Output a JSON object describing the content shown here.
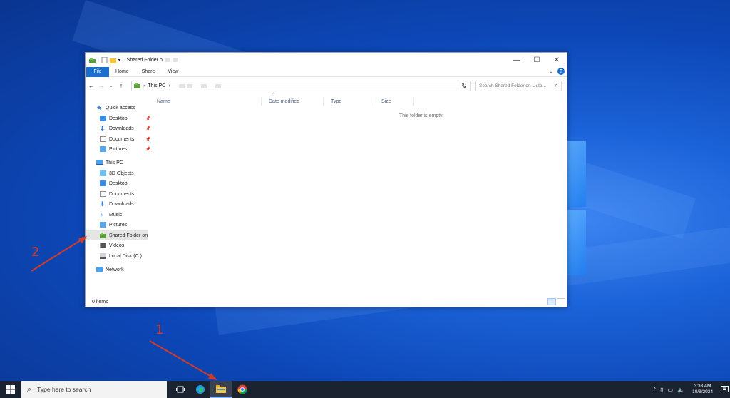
{
  "window": {
    "title": "Shared Folder o",
    "controls": {
      "minimize": "—",
      "maximize": "☐",
      "close": "✕"
    }
  },
  "ribbon": {
    "file_label": "File",
    "tabs": [
      "Home",
      "Share",
      "View"
    ],
    "help_label": "?"
  },
  "address": {
    "crumb_root": "This PC",
    "separator": "›",
    "search_placeholder": "Search Shared Folder on Liuta..."
  },
  "navigation": {
    "quick_access_label": "Quick access",
    "quick_access_items": [
      "Desktop",
      "Downloads",
      "Documents",
      "Pictures"
    ],
    "this_pc_label": "This PC",
    "this_pc_items": [
      "3D Objects",
      "Desktop",
      "Documents",
      "Downloads",
      "Music",
      "Pictures",
      "Shared Folder on",
      "Videos",
      "Local Disk (C:)"
    ],
    "network_label": "Network"
  },
  "columns": [
    "Name",
    "Date modified",
    "Type",
    "Size"
  ],
  "empty_message": "This folder is empty.",
  "status": {
    "items_count": "0 items"
  },
  "annotations": {
    "step1": "1",
    "step2": "2"
  },
  "taskbar": {
    "search_placeholder": "Type here to search",
    "clock_time": "3:33 AM",
    "clock_date": "10/8/2024"
  },
  "colors": {
    "accent": "#1a6ed0",
    "annotation": "#d23b28",
    "taskbar": "#1c2330"
  }
}
